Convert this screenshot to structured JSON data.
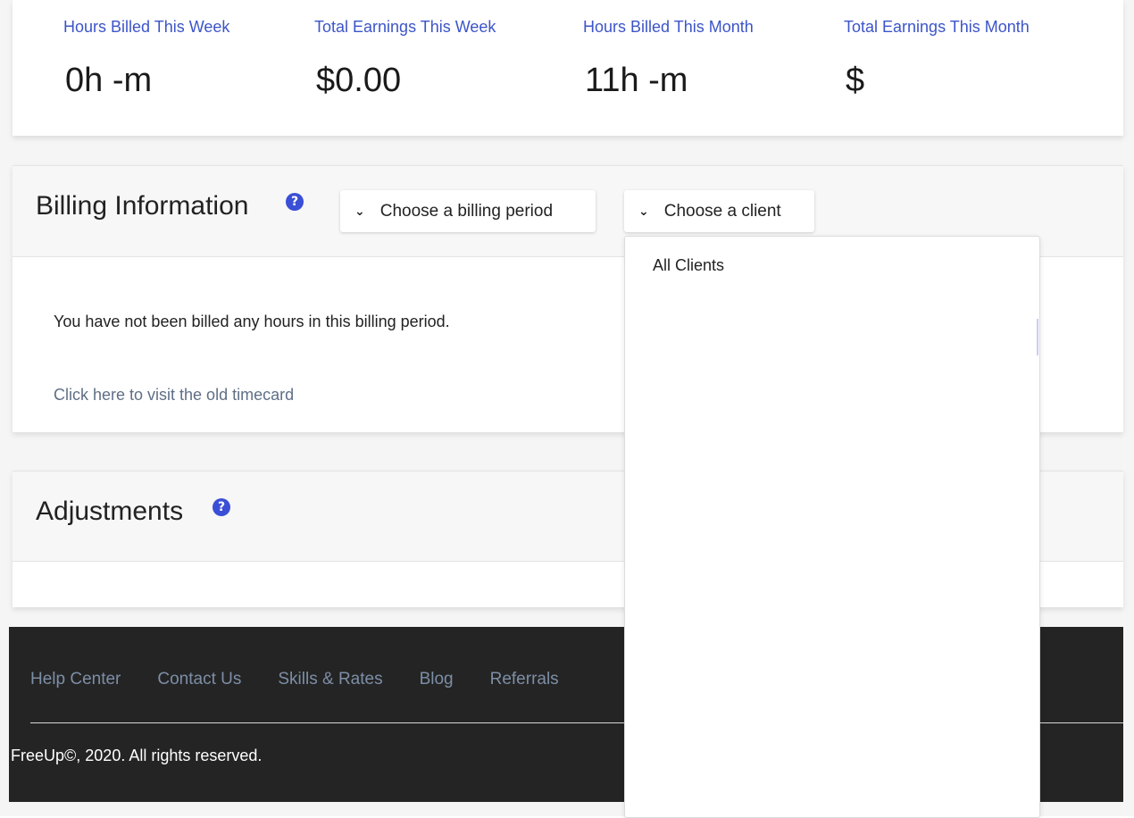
{
  "stats": [
    {
      "label": "Hours Billed This Week",
      "value": "0h -m"
    },
    {
      "label": "Total Earnings This Week",
      "value": "$0.00"
    },
    {
      "label": "Hours Billed This Month",
      "value": "11h -m"
    },
    {
      "label": "Total Earnings This Month",
      "value": "$"
    }
  ],
  "billing": {
    "title": "Billing Information",
    "help_icon": "question-circle-icon",
    "period_dropdown": "Choose a billing period",
    "client_dropdown": "Choose a client",
    "empty_message": "You have not been billed any hours in this billing period.",
    "old_timecard_link": "Click here to visit the old timecard"
  },
  "adjustments": {
    "title": "Adjustments",
    "help_icon": "question-circle-icon"
  },
  "client_menu": {
    "options": [
      "All Clients"
    ]
  },
  "footer": {
    "links": [
      "Help Center",
      "Contact Us",
      "Skills & Rates",
      "Blog",
      "Referrals"
    ],
    "copyright": "FreeUp©, 2020. All rights reserved."
  },
  "colors": {
    "accent_blue": "#3c55c8",
    "help_icon": "#3a4fd6",
    "link_gray": "#5f6f86",
    "footer_bg": "#242424"
  }
}
